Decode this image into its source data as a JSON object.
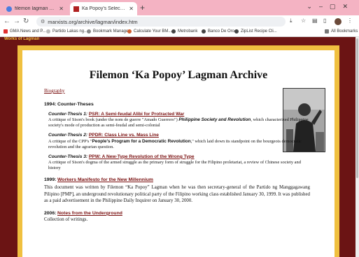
{
  "browser": {
    "tabs": [
      {
        "title": "filemon lagman marxist.org - Go",
        "active": false
      },
      {
        "title": "Ka Popoy's Selected Writings",
        "active": true
      }
    ],
    "new_tab": "+",
    "url": "marxists.org/archive/lagman/index.htm",
    "bookmarks": [
      {
        "label": "GMA News and P..."
      },
      {
        "label": "Partido Lakas ng..."
      },
      {
        "label": "Bookmark Manager"
      },
      {
        "label": "Calculate Your BM..."
      },
      {
        "label": "Metrobank"
      },
      {
        "label": "Banco De Oro"
      },
      {
        "label": "ZipList Recipe Cli..."
      }
    ],
    "all_bookmarks": "All Bookmarks"
  },
  "page": {
    "works_of": "Works of Lagman",
    "title": "Filemon ‘Ka Popoy’ Lagman Archive",
    "biography": "Biography",
    "s1994": {
      "year": "1994:",
      "heading": "Counter-Theses",
      "theses": [
        {
          "label": "Counter-Thesis 1:",
          "link": "PSR: A Semi-feudal Alibi for Protracted War",
          "d1": "A critique of Sison's book (under the nom de guerre \"Amado Guerrero\") ",
          "d2": "Philippine Society and Revolution",
          "d3": ", which characterized Philippine society's mode of production as semi-feudal and semi-colonial"
        },
        {
          "label": "Counter-Thesis 2:",
          "link": "PPDR: Class Line vs. Mass Line",
          "d1": "A critique of the CPP's \"",
          "d2": "People's Program for a Democratic Revolution",
          "d3": ",\" which laid down its standpoint on the bourgeois democratic revolution and the agrarian question."
        },
        {
          "label": "Counter-Thesis 3:",
          "link": "PPW: A New-Type Revolution of the Wrong Type",
          "d1": "A critique of Sison's dogma of the armed struggle as the primary form of struggle for the Filipino proletariat, a review of Chinese society and history",
          "d2": "",
          "d3": ""
        }
      ]
    },
    "s1999": {
      "year": "1999:",
      "link": "Workers Manifesto for the New Millennium",
      "text": "This document was written by Filemon “Ka Popoy” Lagman when he was then secretary-general of the Partido ng Manggagawang Pilipino [PMP], an underground revolutionary political party of the Filipino working class established January 30, 1999. It was published as a paid advertisement in the Philippine Daily Inquirer on January 30, 2000."
    },
    "s2006": {
      "year": "2006:",
      "link": "Notes from the Underground",
      "text": "Collection of writings."
    }
  }
}
